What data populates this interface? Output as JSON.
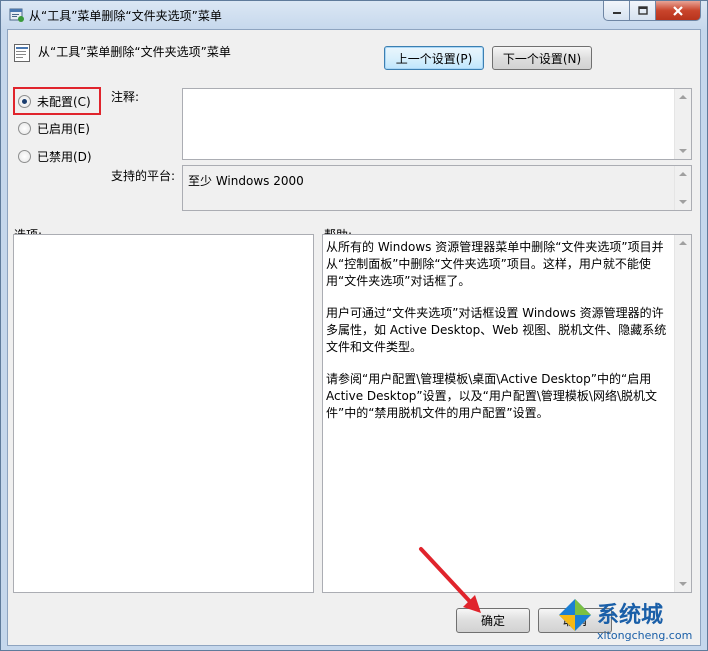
{
  "window": {
    "title": "从“工具”菜单删除“文件夹选项”菜单"
  },
  "header": {
    "title": "从“工具”菜单删除“文件夹选项”菜单",
    "prev_button": "上一个设置(P)",
    "next_button": "下一个设置(N)"
  },
  "state": {
    "options": [
      {
        "label": "未配置(C)",
        "selected": true
      },
      {
        "label": "已启用(E)",
        "selected": false
      },
      {
        "label": "已禁用(D)",
        "selected": false
      }
    ]
  },
  "comment": {
    "label": "注释:",
    "value": ""
  },
  "platform": {
    "label": "支持的平台:",
    "value": "至少 Windows 2000"
  },
  "options_section": {
    "label": "选项:"
  },
  "help": {
    "label": "帮助:",
    "paragraphs": [
      "从所有的 Windows 资源管理器菜单中删除“文件夹选项”项目并从“控制面板”中删除“文件夹选项”项目。这样，用户就不能使用“文件夹选项”对话框了。",
      "用户可通过“文件夹选项”对话框设置 Windows 资源管理器的许多属性，如 Active Desktop、Web 视图、脱机文件、隐藏系统文件和文件类型。",
      "请参阅“用户配置\\管理模板\\桌面\\Active Desktop”中的“启用 Active Desktop”设置，以及“用户配置\\管理模板\\网络\\脱机文件”中的“禁用脱机文件的用户配置”设置。"
    ]
  },
  "footer": {
    "ok_button": "确定",
    "cancel_button": "取消"
  },
  "watermark": {
    "brand": "系统城",
    "url": "xitongcheng.com"
  },
  "colors": {
    "highlight_box": "#e0242c",
    "arrow": "#e0242c",
    "focus_border": "#3c7fb1"
  }
}
